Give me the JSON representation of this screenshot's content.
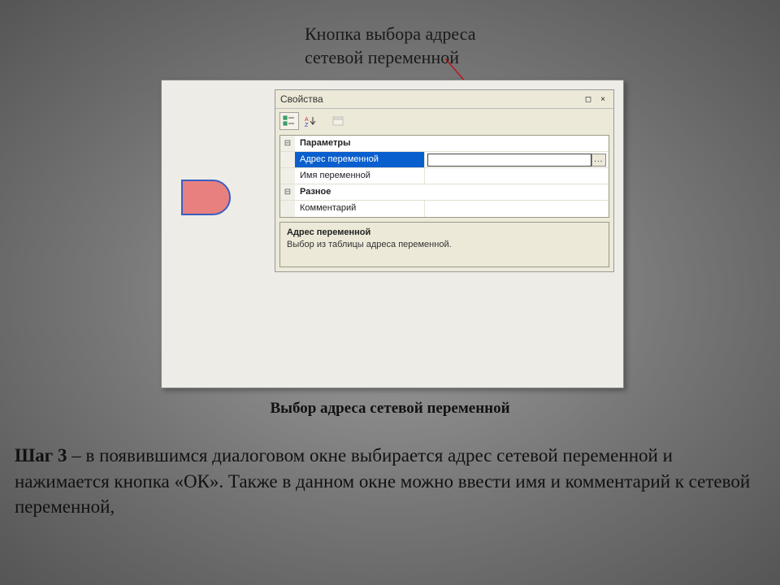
{
  "annotation_top": {
    "line1": "Кнопка выбора адреса",
    "line2": "сетевой переменной"
  },
  "panel": {
    "title": "Свойства",
    "minimize": "◻",
    "close": "×",
    "ellipsis": "...",
    "groups": {
      "params_label": "Параметры",
      "misc_label": "Разное"
    },
    "rows": {
      "addr_label": "Адрес переменной",
      "addr_value": "",
      "name_label": "Имя переменной",
      "name_value": "",
      "comment_label": "Комментарий",
      "comment_value": ""
    },
    "desc": {
      "title": "Адрес переменной",
      "text": "Выбор из таблицы адреса переменной."
    }
  },
  "caption": "Выбор адреса сетевой переменной",
  "step": {
    "prefix": "Шаг 3 ",
    "body": "– в появившимся диалоговом окне выбирается адрес сетевой переменной и нажимается кнопка «ОК». Также в данном окне можно ввести имя и комментарий к сетевой переменной,"
  }
}
